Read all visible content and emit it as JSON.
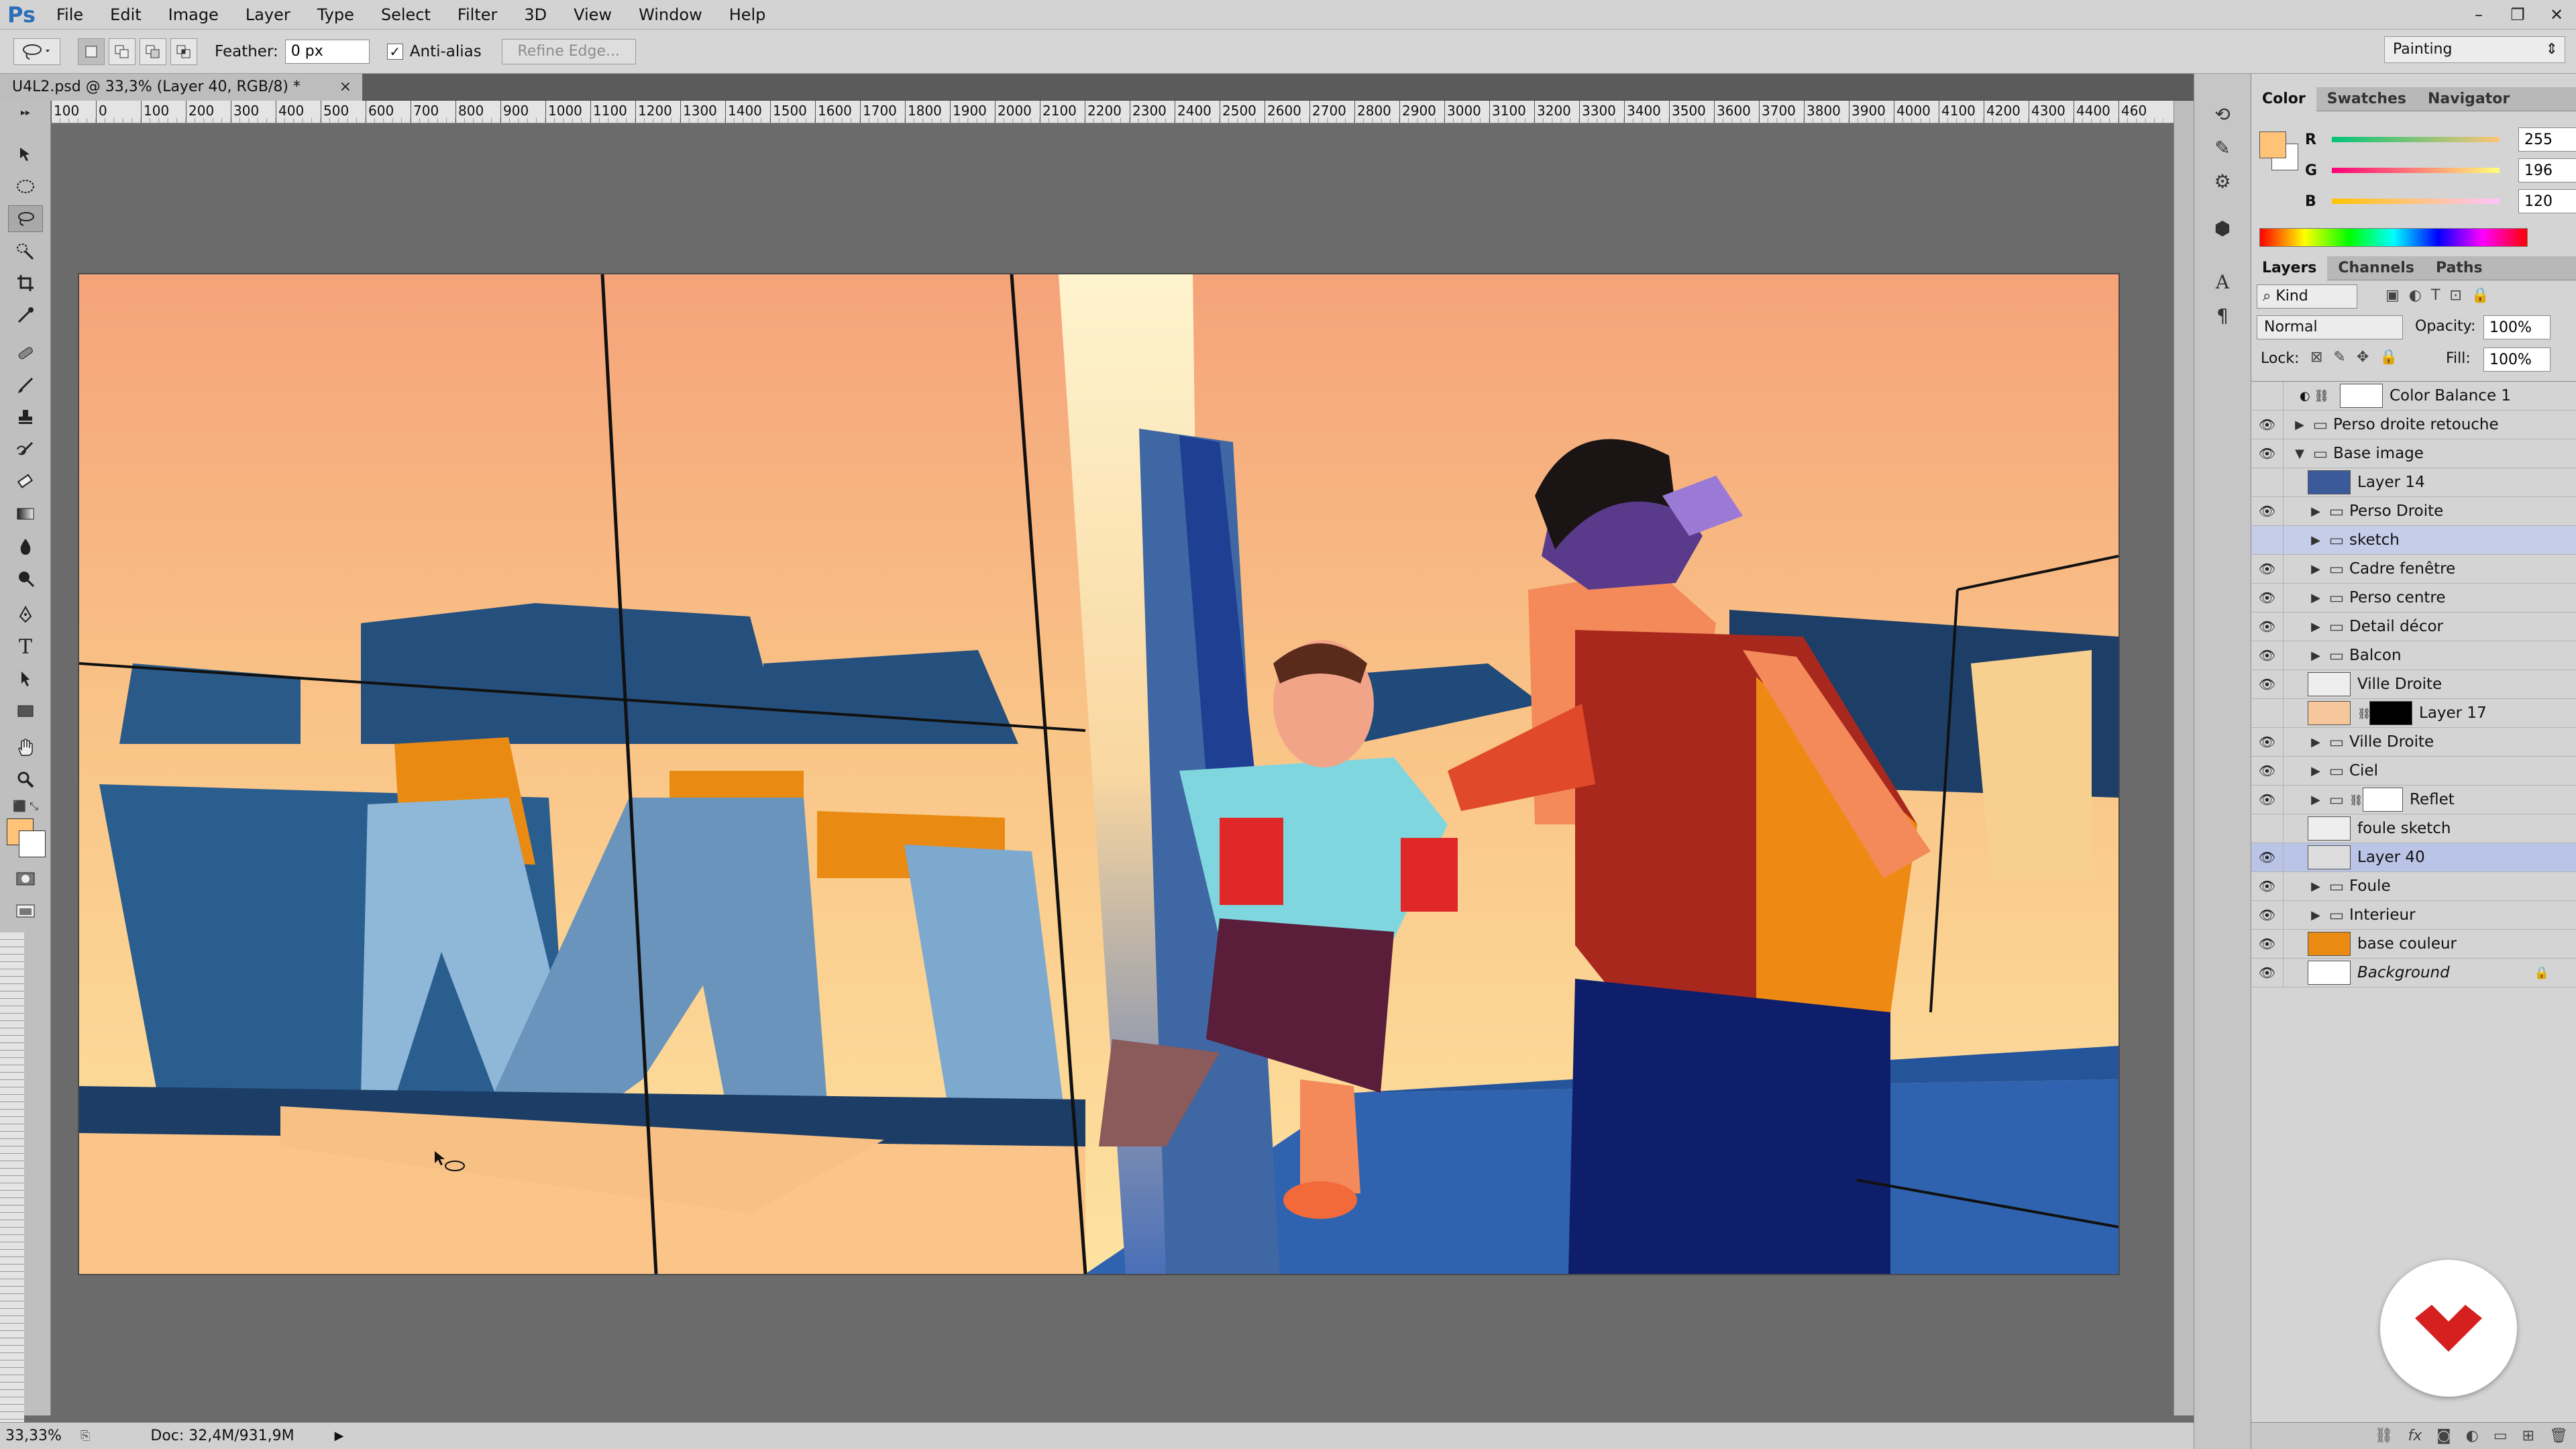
{
  "app": {
    "logo": "Ps"
  },
  "menu": [
    "File",
    "Edit",
    "Image",
    "Layer",
    "Type",
    "Select",
    "Filter",
    "3D",
    "View",
    "Window",
    "Help"
  ],
  "window_controls": [
    "–",
    "❐",
    "✕"
  ],
  "options": {
    "feather_label": "Feather:",
    "feather_value": "0 px",
    "antialias_label": "Anti-alias",
    "antialias_checked": "✓",
    "refine_label": "Refine Edge...",
    "workspace": "Painting"
  },
  "document": {
    "tab_title": "U4L2.psd @ 33,3% (Layer 40, RGB/8) *",
    "tab_close": "×"
  },
  "ruler": {
    "ticks": [
      "100",
      "0",
      "100",
      "200",
      "300",
      "400",
      "500",
      "600",
      "700",
      "800",
      "900",
      "1000",
      "1100",
      "1200",
      "1300",
      "1400",
      "1500",
      "1600",
      "1700",
      "1800",
      "1900",
      "2000",
      "2100",
      "2200",
      "2300",
      "2400",
      "2500",
      "2600",
      "2700",
      "2800",
      "2900",
      "3000",
      "3100",
      "3200",
      "3300",
      "3400",
      "3500",
      "3600",
      "3700",
      "3800",
      "3900",
      "4000",
      "4100",
      "4200",
      "4300",
      "4400",
      "460"
    ]
  },
  "status": {
    "zoom": "33,33%",
    "doc": "Doc: 32,4M/931,9M"
  },
  "color_panel": {
    "tabs": [
      "Color",
      "Swatches",
      "Navigator"
    ],
    "foreground": "#ffc478",
    "background": "#ffffff",
    "r_label": "R",
    "r_value": "255",
    "g_label": "G",
    "g_value": "196",
    "b_label": "B",
    "b_value": "120"
  },
  "layers_panel": {
    "tabs": [
      "Layers",
      "Channels",
      "Paths"
    ],
    "kind": "Kind",
    "blend_mode": "Normal",
    "opacity_label": "Opacity:",
    "opacity_value": "100%",
    "lock_label": "Lock:",
    "fill_label": "Fill:",
    "fill_value": "100%",
    "layers": [
      {
        "name": "Color Balance 1",
        "visible": false,
        "type": "adjustment"
      },
      {
        "name": "Perso droite retouche",
        "visible": true,
        "type": "group",
        "indent": 0
      },
      {
        "name": "Base image",
        "visible": true,
        "type": "group-open",
        "indent": 0
      },
      {
        "name": "Layer 14",
        "visible": false,
        "type": "layer",
        "thumb": "#3a5a9a"
      },
      {
        "name": "Perso Droite",
        "visible": true,
        "type": "group",
        "indent": 1
      },
      {
        "name": "sketch",
        "visible": false,
        "type": "group",
        "indent": 1,
        "highlight": true
      },
      {
        "name": "Cadre fenêtre",
        "visible": true,
        "type": "group",
        "indent": 1
      },
      {
        "name": "Perso centre",
        "visible": true,
        "type": "group",
        "indent": 1
      },
      {
        "name": "Detail décor",
        "visible": true,
        "type": "group",
        "indent": 1
      },
      {
        "name": "Balcon",
        "visible": true,
        "type": "group",
        "indent": 1
      },
      {
        "name": "Ville Droite",
        "visible": true,
        "type": "layer",
        "thumb": "#eeeeee"
      },
      {
        "name": "Layer 17",
        "visible": false,
        "type": "masked",
        "thumb": "#f6c79a"
      },
      {
        "name": "Ville Droite",
        "visible": true,
        "type": "group",
        "indent": 1
      },
      {
        "name": "Ciel",
        "visible": true,
        "type": "group",
        "indent": 1
      },
      {
        "name": "Reflet",
        "visible": true,
        "type": "group-masked",
        "indent": 1
      },
      {
        "name": "foule sketch",
        "visible": false,
        "type": "layer",
        "thumb": "#eeeeee"
      },
      {
        "name": "Layer 40",
        "visible": true,
        "type": "layer",
        "thumb": "#dddddd",
        "selected": true
      },
      {
        "name": "Foule",
        "visible": true,
        "type": "group",
        "indent": 1
      },
      {
        "name": "Interieur",
        "visible": true,
        "type": "group",
        "indent": 1
      },
      {
        "name": "base couleur",
        "visible": true,
        "type": "layer",
        "thumb": "#e98a12"
      },
      {
        "name": "Background",
        "visible": true,
        "type": "background",
        "thumb": "#ffffff"
      }
    ]
  },
  "colors": {
    "ps_blue": "#2b6fb8",
    "selection": "#b9c4e6",
    "badge_red": "#d61f1f"
  }
}
